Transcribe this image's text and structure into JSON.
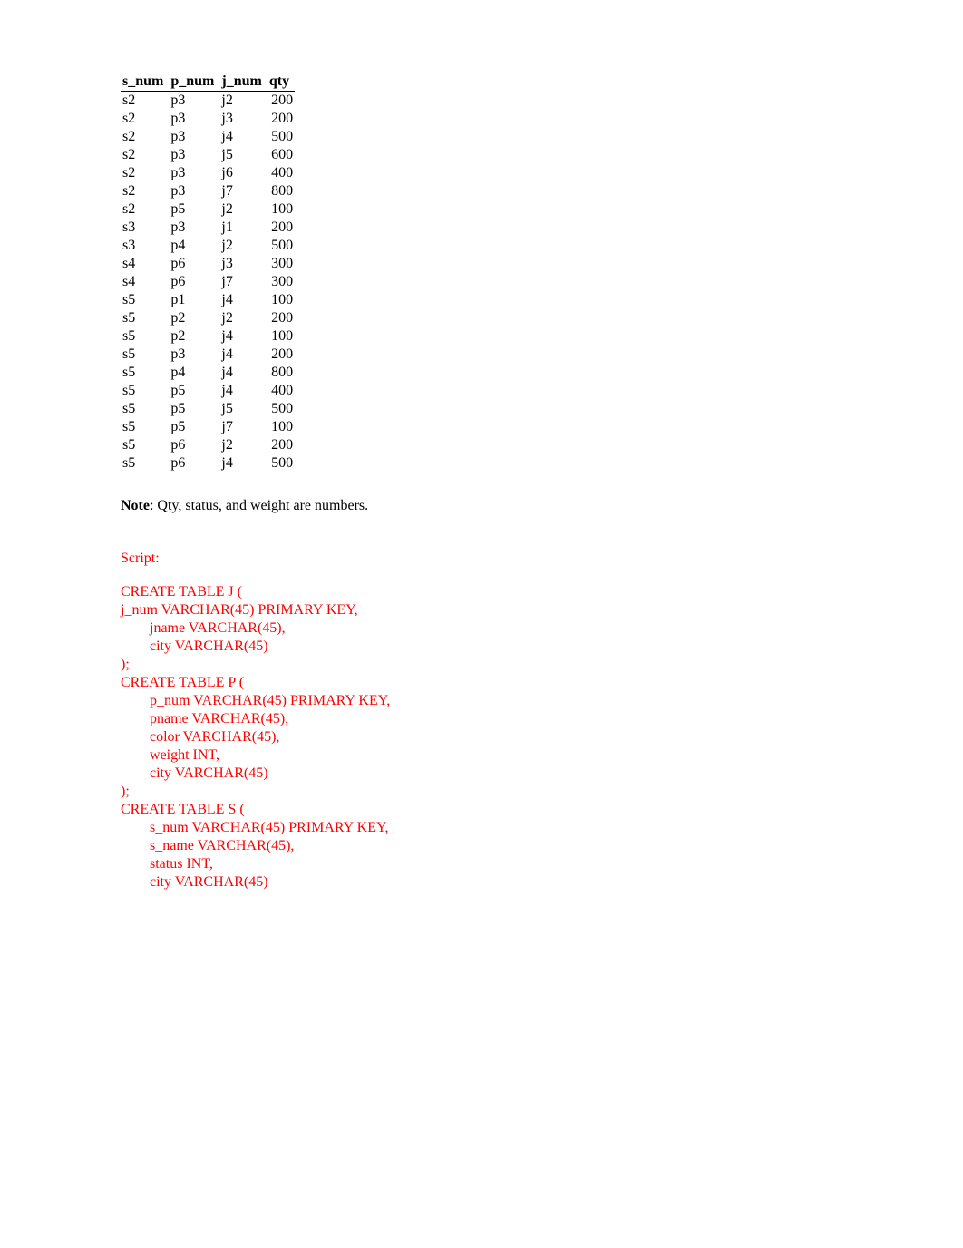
{
  "table": {
    "headers": [
      "s_num",
      "p_num",
      "j_num",
      "qty"
    ],
    "rows": [
      {
        "s_num": "s2",
        "p_num": "p3",
        "j_num": "j2",
        "qty": 200
      },
      {
        "s_num": "s2",
        "p_num": "p3",
        "j_num": "j3",
        "qty": 200
      },
      {
        "s_num": "s2",
        "p_num": "p3",
        "j_num": "j4",
        "qty": 500
      },
      {
        "s_num": "s2",
        "p_num": "p3",
        "j_num": "j5",
        "qty": 600
      },
      {
        "s_num": "s2",
        "p_num": "p3",
        "j_num": "j6",
        "qty": 400
      },
      {
        "s_num": "s2",
        "p_num": "p3",
        "j_num": "j7",
        "qty": 800
      },
      {
        "s_num": "s2",
        "p_num": "p5",
        "j_num": "j2",
        "qty": 100
      },
      {
        "s_num": "s3",
        "p_num": "p3",
        "j_num": "j1",
        "qty": 200
      },
      {
        "s_num": "s3",
        "p_num": "p4",
        "j_num": "j2",
        "qty": 500
      },
      {
        "s_num": "s4",
        "p_num": "p6",
        "j_num": "j3",
        "qty": 300
      },
      {
        "s_num": "s4",
        "p_num": "p6",
        "j_num": "j7",
        "qty": 300
      },
      {
        "s_num": "s5",
        "p_num": "p1",
        "j_num": "j4",
        "qty": 100
      },
      {
        "s_num": "s5",
        "p_num": "p2",
        "j_num": "j2",
        "qty": 200
      },
      {
        "s_num": "s5",
        "p_num": "p2",
        "j_num": "j4",
        "qty": 100
      },
      {
        "s_num": "s5",
        "p_num": "p3",
        "j_num": "j4",
        "qty": 200
      },
      {
        "s_num": "s5",
        "p_num": "p4",
        "j_num": "j4",
        "qty": 800
      },
      {
        "s_num": "s5",
        "p_num": "p5",
        "j_num": "j4",
        "qty": 400
      },
      {
        "s_num": "s5",
        "p_num": "p5",
        "j_num": "j5",
        "qty": 500
      },
      {
        "s_num": "s5",
        "p_num": "p5",
        "j_num": "j7",
        "qty": 100
      },
      {
        "s_num": "s5",
        "p_num": "p6",
        "j_num": "j2",
        "qty": 200
      },
      {
        "s_num": "s5",
        "p_num": "p6",
        "j_num": "j4",
        "qty": 500
      }
    ]
  },
  "note": {
    "label": "Note",
    "text": ": Qty, status, and weight are numbers."
  },
  "script": {
    "label": "Script:",
    "code": "CREATE TABLE J (\nj_num VARCHAR(45) PRIMARY KEY,\n        jname VARCHAR(45),\n        city VARCHAR(45)\n);\nCREATE TABLE P (\n        p_num VARCHAR(45) PRIMARY KEY,\n        pname VARCHAR(45),\n        color VARCHAR(45),\n        weight INT,\n        city VARCHAR(45)\n);\nCREATE TABLE S (\n        s_num VARCHAR(45) PRIMARY KEY,\n        s_name VARCHAR(45),\n        status INT,\n        city VARCHAR(45)"
  }
}
